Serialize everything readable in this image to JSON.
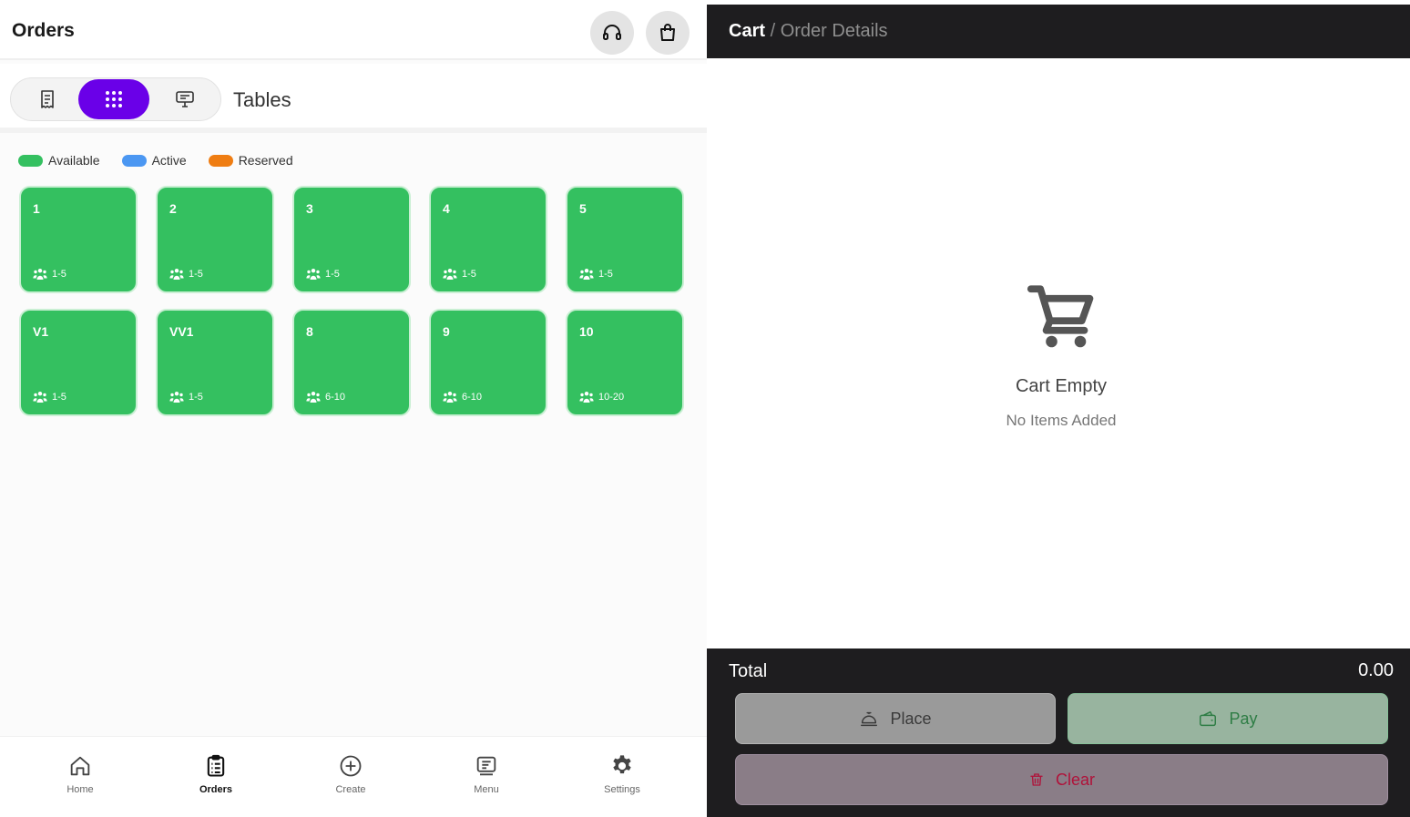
{
  "left": {
    "title": "Orders",
    "header_icons": [
      "headset-icon",
      "shopping-bag-icon"
    ],
    "view_toggle": {
      "options": [
        "receipt-icon",
        "grid-dots-icon",
        "monitor-icon"
      ],
      "selected": "grid-dots-icon"
    },
    "section_label": "Tables",
    "legend": [
      {
        "label": "Available",
        "color": "#34c060"
      },
      {
        "label": "Active",
        "color": "#4b97f2"
      },
      {
        "label": "Reserved",
        "color": "#ef7d12"
      }
    ],
    "tables": [
      {
        "name": "1",
        "capacity": "1-5",
        "status": "Available"
      },
      {
        "name": "2",
        "capacity": "1-5",
        "status": "Available"
      },
      {
        "name": "3",
        "capacity": "1-5",
        "status": "Available"
      },
      {
        "name": "4",
        "capacity": "1-5",
        "status": "Available"
      },
      {
        "name": "5",
        "capacity": "1-5",
        "status": "Available"
      },
      {
        "name": "V1",
        "capacity": "1-5",
        "status": "Available"
      },
      {
        "name": "VV1",
        "capacity": "1-5",
        "status": "Available"
      },
      {
        "name": "8",
        "capacity": "6-10",
        "status": "Available"
      },
      {
        "name": "9",
        "capacity": "6-10",
        "status": "Available"
      },
      {
        "name": "10",
        "capacity": "10-20",
        "status": "Available"
      }
    ],
    "nav": [
      {
        "label": "Home",
        "icon": "home-icon",
        "active": false
      },
      {
        "label": "Orders",
        "icon": "clipboard-icon",
        "active": true
      },
      {
        "label": "Create",
        "icon": "plus-circle-icon",
        "active": false
      },
      {
        "label": "Menu",
        "icon": "menu-card-icon",
        "active": false
      },
      {
        "label": "Settings",
        "icon": "gear-icon",
        "active": false
      }
    ]
  },
  "right": {
    "breadcrumb": {
      "current": "Cart",
      "separator": "/",
      "next": "Order Details"
    },
    "empty": {
      "icon": "cart-icon",
      "title": "Cart Empty",
      "subtitle": "No Items Added"
    },
    "total_label": "Total",
    "total_value": "0.00",
    "buttons": {
      "place": {
        "label": "Place",
        "icon": "service-bell-icon"
      },
      "pay": {
        "label": "Pay",
        "icon": "wallet-icon"
      },
      "clear": {
        "label": "Clear",
        "icon": "trash-icon"
      }
    }
  },
  "colors": {
    "accent": "#6a00e8",
    "table_available": "#34c060",
    "dark_panel": "#1e1d1f"
  }
}
